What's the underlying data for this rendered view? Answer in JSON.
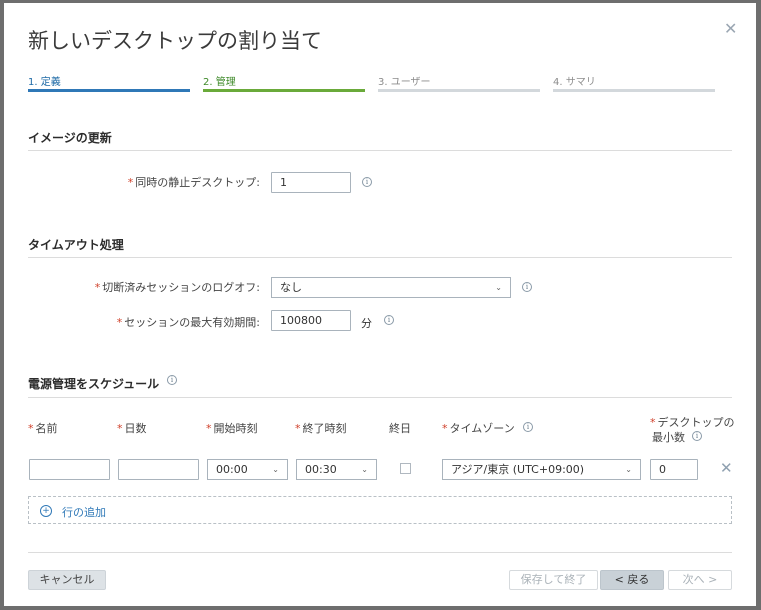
{
  "dialog": {
    "title": "新しいデスクトップの割り当て",
    "close_glyph": "✕"
  },
  "steps": [
    {
      "label": "1. 定義",
      "state": "completed",
      "color": "#2f78b7"
    },
    {
      "label": "2. 管理",
      "state": "current",
      "color": "#6aaa3a"
    },
    {
      "label": "3. ユーザー",
      "state": "pending"
    },
    {
      "label": "4. サマリ",
      "state": "pending"
    }
  ],
  "image_update": {
    "heading": "イメージの更新",
    "concurrent_label": "同時の静止デスクトップ:",
    "concurrent_value": "1"
  },
  "timeout": {
    "heading": "タイムアウト処理",
    "logoff_label": "切断済みセッションのログオフ:",
    "logoff_value": "なし",
    "max_label": "セッションの最大有効期間:",
    "max_value": "100800",
    "max_unit": "分"
  },
  "schedule": {
    "heading": "電源管理をスケジュール",
    "columns": {
      "name": "名前",
      "days": "日数",
      "start": "開始時刻",
      "end": "終了時刻",
      "all_day": "終日",
      "timezone": "タイムゾーン",
      "min_desktops_line1": "デスクトップの",
      "min_desktops_line2": "最小数"
    },
    "row": {
      "name": "",
      "days": "",
      "start": "00:00",
      "end": "00:30",
      "all_day": false,
      "timezone": "アジア/東京 (UTC+09:00)",
      "min_desktops": "0"
    },
    "add_row_label": "行の追加"
  },
  "required_mark": "*",
  "info_glyph": "i",
  "chevron_glyph": "⌄",
  "plus_glyph": "+",
  "remove_glyph": "✕",
  "footer": {
    "cancel": "キャンセル",
    "save_exit": "保存して終了",
    "back": "< 戻る",
    "next": "次へ >"
  }
}
